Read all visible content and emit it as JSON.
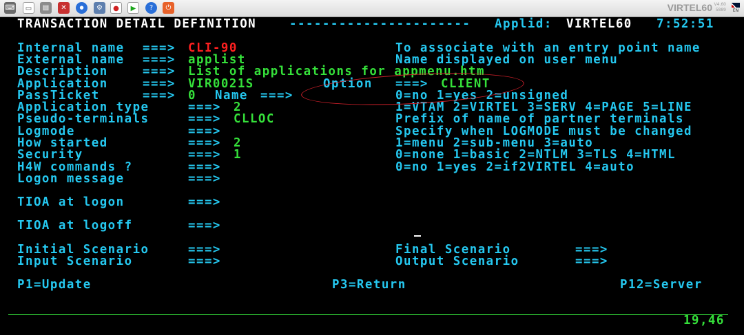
{
  "toolbar": {
    "icons": [
      "keyboard-icon",
      "clipboard-icon",
      "disconnect-icon",
      "capture-icon",
      "settings-icon",
      "record-icon",
      "play-icon",
      "help-icon",
      "power-icon"
    ],
    "brand": "VIRTEL60",
    "version_line1": "V4.60",
    "version_line2": "5889",
    "lang": "EN"
  },
  "header": {
    "title": "TRANSACTION DETAIL DEFINITION",
    "dashes": "----------------------",
    "applid_label": "Applid:",
    "applid": "VIRTEL60",
    "time": "7:52:51"
  },
  "fields": {
    "internal_name": {
      "label": "Internal name",
      "arrow": "===>",
      "value": "CLI-90"
    },
    "external_name": {
      "label": "External name",
      "arrow": "===>",
      "value": "applist"
    },
    "description": {
      "label": "Description",
      "arrow": "===>",
      "value": "List of applications for appmenu.htm"
    },
    "application": {
      "label": "Application",
      "arrow": "===>",
      "value": "VIR0021S"
    },
    "option": {
      "label": "Option",
      "arrow": "===>",
      "value": "CLIENT"
    },
    "passticket": {
      "label": "PassTicket",
      "arrow": "===>",
      "value": "0"
    },
    "passticket_name": {
      "label": "Name",
      "arrow": "===>"
    },
    "application_type": {
      "label": "Application type",
      "arrow": "===>",
      "value": "2"
    },
    "pseudo_terminals": {
      "label": "Pseudo-terminals",
      "arrow": "===>",
      "value": "CLLOC"
    },
    "logmode": {
      "label": "Logmode",
      "arrow": "===>",
      "value": ""
    },
    "how_started": {
      "label": "How started",
      "arrow": "===>",
      "value": "2"
    },
    "security": {
      "label": "Security",
      "arrow": "===>",
      "value": "1"
    },
    "h4w_commands": {
      "label": "H4W commands ?",
      "arrow": "===>",
      "value": ""
    },
    "logon_message": {
      "label": "Logon message",
      "arrow": "===>",
      "value": ""
    },
    "tioa_logon": {
      "label": "TIOA at logon",
      "arrow": "===>",
      "value": ""
    },
    "tioa_logoff": {
      "label": "TIOA at logoff",
      "arrow": "===>",
      "value": ""
    },
    "initial_scenario": {
      "label": "Initial Scenario",
      "arrow": "===>",
      "value": ""
    },
    "input_scenario": {
      "label": "Input Scenario",
      "arrow": "===>",
      "value": ""
    },
    "final_scenario": {
      "label": "Final Scenario",
      "arrow": "===>",
      "value": ""
    },
    "output_scenario": {
      "label": "Output Scenario",
      "arrow": "===>",
      "value": ""
    }
  },
  "help": {
    "internal": "To associate with an entry point name",
    "external": "Name displayed on user menu",
    "passticket": "0=no 1=yes 2=unsigned",
    "app_type": "1=VTAM 2=VIRTEL 3=SERV 4=PAGE 5=LINE",
    "pseudo": "Prefix of name of partner terminals",
    "logmode": "Specify when LOGMODE must be changed",
    "how_started": "1=menu 2=sub-menu 3=auto",
    "security": "0=none 1=basic 2=NTLM 3=TLS 4=HTML",
    "h4w": "0=no 1=yes 2=if2VIRTEL 4=auto"
  },
  "pfkeys": {
    "p1": "P1=Update",
    "p3": "P3=Return",
    "p12": "P12=Server"
  },
  "status": {
    "cursor_pos": "19,46"
  },
  "annotation_color": "#d0202a"
}
